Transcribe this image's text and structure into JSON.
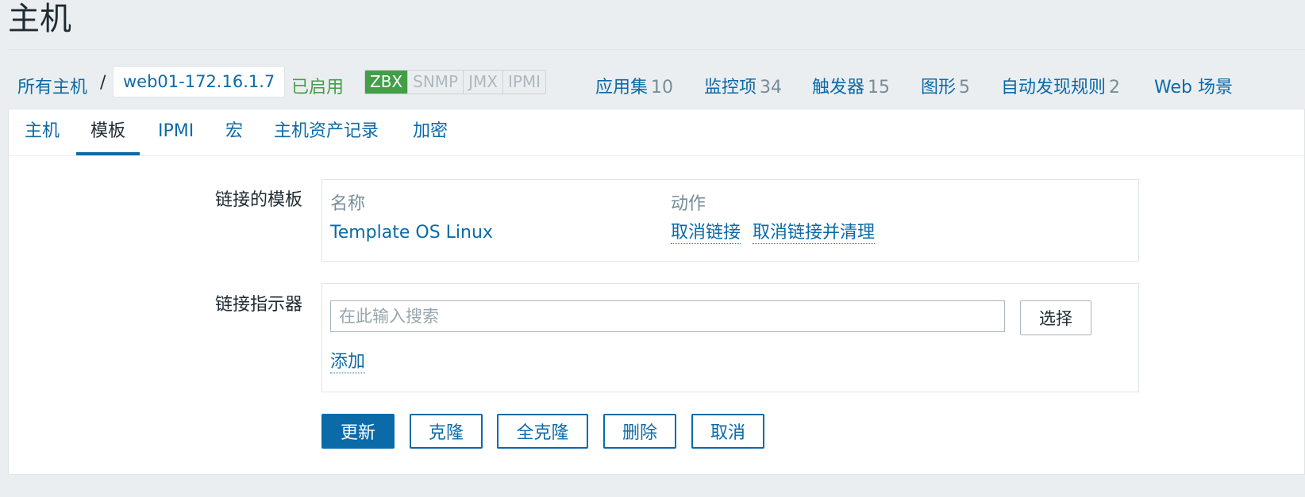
{
  "page_title": "主机",
  "breadcrumb": {
    "all_hosts": "所有主机",
    "separator": "/",
    "current_host": "web01-172.16.1.7"
  },
  "status": "已启用",
  "availability": [
    {
      "label": "ZBX",
      "active": true
    },
    {
      "label": "SNMP",
      "active": false
    },
    {
      "label": "JMX",
      "active": false
    },
    {
      "label": "IPMI",
      "active": false
    }
  ],
  "nav_links": [
    {
      "label": "应用集",
      "count": "10"
    },
    {
      "label": "监控项",
      "count": "34"
    },
    {
      "label": "触发器",
      "count": "15"
    },
    {
      "label": "图形",
      "count": "5"
    },
    {
      "label": "自动发现规则",
      "count": "2"
    },
    {
      "label": "Web 场景",
      "count": ""
    }
  ],
  "tabs": [
    "主机",
    "模板",
    "IPMI",
    "宏",
    "主机资产记录",
    "加密"
  ],
  "active_tab": "模板",
  "linked_templates": {
    "label": "链接的模板",
    "col_name": "名称",
    "col_action": "动作",
    "rows": [
      {
        "name": "Template OS Linux",
        "unlink": "取消链接",
        "unlink_clear": "取消链接并清理"
      }
    ]
  },
  "link_new": {
    "label": "链接指示器",
    "placeholder": "在此输入搜索",
    "select_label": "选择",
    "add_label": "添加"
  },
  "actions": {
    "update": "更新",
    "clone": "克隆",
    "full_clone": "全克隆",
    "delete": "删除",
    "cancel": "取消"
  },
  "colors": {
    "link": "#0b6aa8",
    "enabled": "#429e47",
    "background": "#ebeef0"
  }
}
